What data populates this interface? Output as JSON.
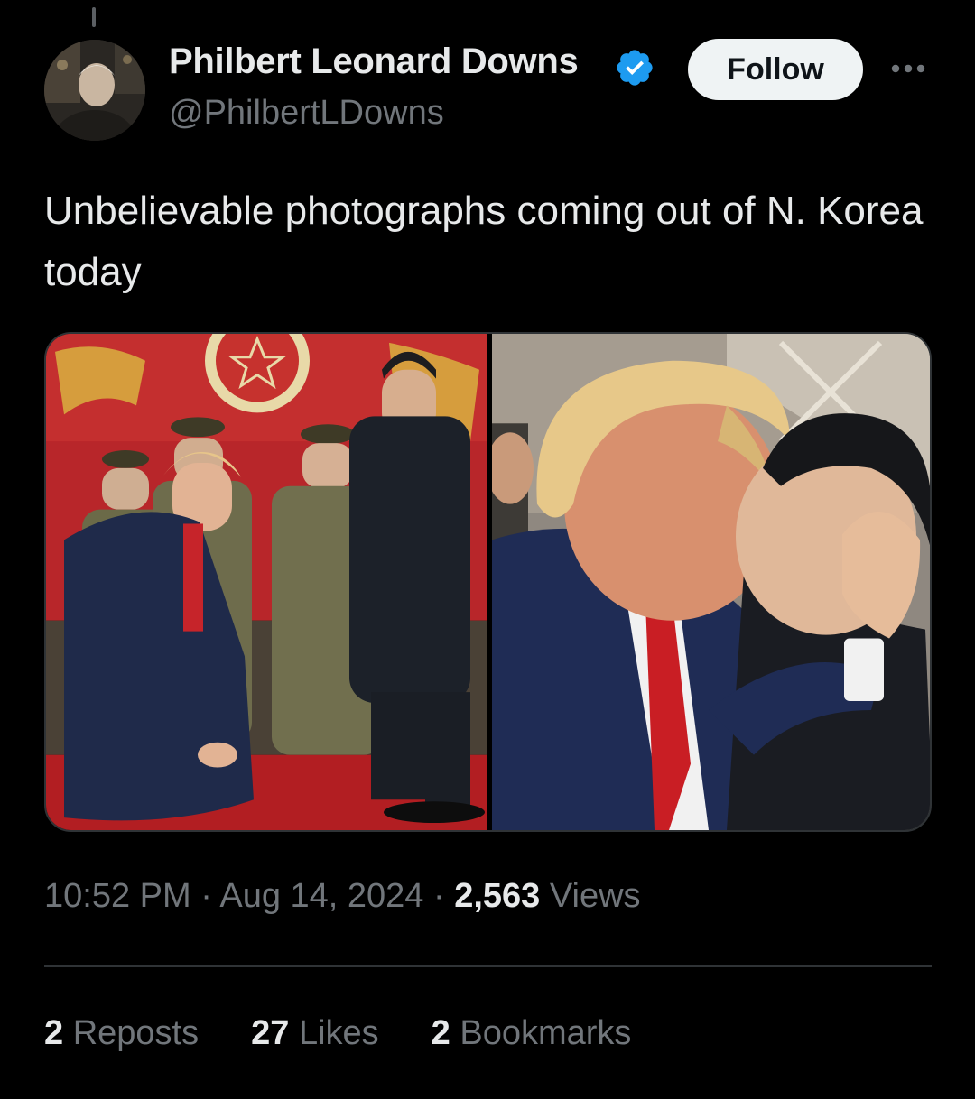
{
  "tweet": {
    "author": {
      "display_name": "Philbert Leonard Downs",
      "handle": "@PhilbertLDowns",
      "verified": true
    },
    "follow_label": "Follow",
    "text": "Unbelievable photographs coming out of N. Korea today",
    "media": {
      "count": 2
    },
    "time": "10:52 PM",
    "separator": "·",
    "date": "Aug 14, 2024",
    "views_count": "2,563",
    "views_label": "Views",
    "stats": {
      "reposts_count": "2",
      "reposts_label": "Reposts",
      "likes_count": "27",
      "likes_label": "Likes",
      "bookmarks_count": "2",
      "bookmarks_label": "Bookmarks"
    }
  },
  "colors": {
    "background": "#000000",
    "text_primary": "#e7e9ea",
    "text_secondary": "#71767b",
    "verified_blue": "#1d9bf0",
    "follow_button_bg": "#eff3f4",
    "divider": "#2f3336"
  },
  "icons": [
    "verified-badge-icon",
    "more-options-icon"
  ]
}
